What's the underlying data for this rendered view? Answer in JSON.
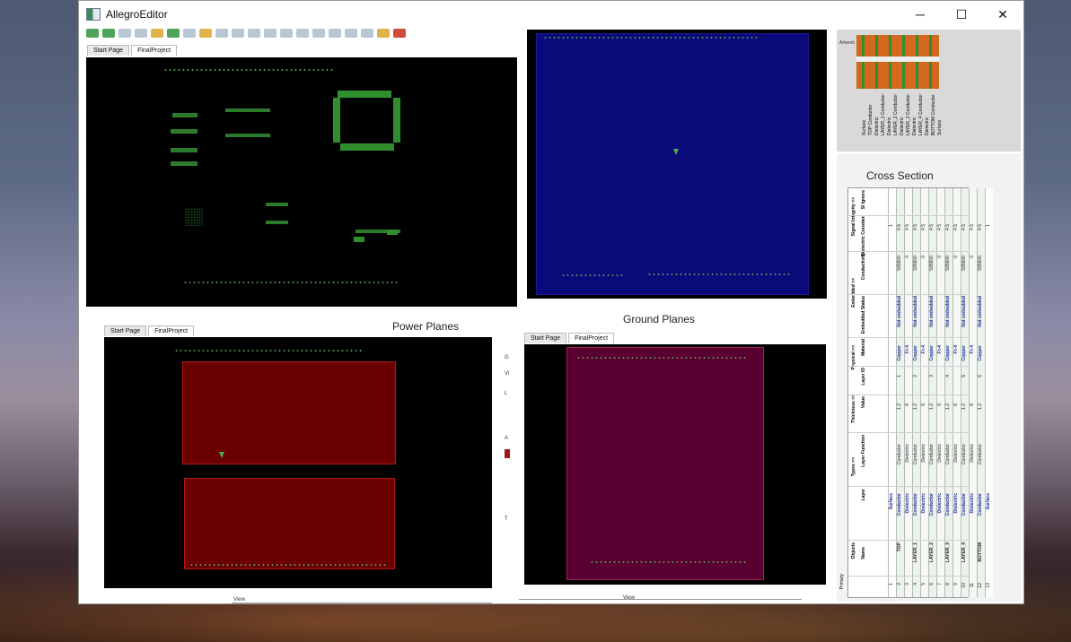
{
  "app": {
    "title": "AllegroEditor"
  },
  "window_controls": {
    "minimize": "─",
    "maximize": "☐",
    "close": "✕"
  },
  "tabs": {
    "start_page": "Start Page",
    "final_project": "FinalProject"
  },
  "captions": {
    "power_planes": "Power Planes",
    "ground_planes": "Ground Planes",
    "cross_section": "Cross Section"
  },
  "cross_section_table": {
    "group_headers": [
      "Objects",
      "Types >>",
      "Thickness >>",
      "Physical >>",
      "Embedded >>",
      "Signal Integrity >>"
    ],
    "column_headers": [
      "Name",
      "Layer",
      "Layer Function",
      "Value",
      "Layer ID",
      "Material",
      "Embedded Status",
      "Conductivity",
      "Dielectric Constant",
      "SI Ignore"
    ],
    "unit_headers": [
      "mil",
      "mho/cm"
    ],
    "side_label": "Primary",
    "rows": [
      {
        "num": "1",
        "name": "",
        "layer": "Surface",
        "function": "",
        "thickness": "",
        "id": "",
        "material": "",
        "embedded": "",
        "cond": "",
        "dk": "1"
      },
      {
        "num": "2",
        "name": "TOP",
        "layer": "Conductor",
        "function": "Conductor",
        "thickness": "1.2",
        "id": "1",
        "material": "Copper",
        "embedded": "Not embedded",
        "cond": "595900",
        "dk": "4.5"
      },
      {
        "num": "3",
        "name": "",
        "layer": "Dielectric",
        "function": "Dielectric",
        "thickness": "8",
        "id": "",
        "material": "Fr-4",
        "embedded": "",
        "cond": "0",
        "dk": "4.5"
      },
      {
        "num": "4",
        "name": "LAYER_1",
        "layer": "Conductor",
        "function": "Conductor",
        "thickness": "1.2",
        "id": "2",
        "material": "Copper",
        "embedded": "Not embedded",
        "cond": "595900",
        "dk": "4.5"
      },
      {
        "num": "5",
        "name": "",
        "layer": "Dielectric",
        "function": "Dielectric",
        "thickness": "8",
        "id": "",
        "material": "Fr-4",
        "embedded": "",
        "cond": "0",
        "dk": "4.5"
      },
      {
        "num": "6",
        "name": "LAYER_2",
        "layer": "Conductor",
        "function": "Conductor",
        "thickness": "1.2",
        "id": "3",
        "material": "Copper",
        "embedded": "Not embedded",
        "cond": "595900",
        "dk": "4.5"
      },
      {
        "num": "7",
        "name": "",
        "layer": "Dielectric",
        "function": "Dielectric",
        "thickness": "8",
        "id": "",
        "material": "Fr-4",
        "embedded": "",
        "cond": "0",
        "dk": "4.5"
      },
      {
        "num": "8",
        "name": "LAYER_3",
        "layer": "Conductor",
        "function": "Conductor",
        "thickness": "1.2",
        "id": "4",
        "material": "Copper",
        "embedded": "Not embedded",
        "cond": "595900",
        "dk": "4.5"
      },
      {
        "num": "9",
        "name": "",
        "layer": "Dielectric",
        "function": "Dielectric",
        "thickness": "8",
        "id": "",
        "material": "Fr-4",
        "embedded": "",
        "cond": "0",
        "dk": "4.5"
      },
      {
        "num": "10",
        "name": "LAYER_4",
        "layer": "Conductor",
        "function": "Conductor",
        "thickness": "1.2",
        "id": "5",
        "material": "Copper",
        "embedded": "Not embedded",
        "cond": "595900",
        "dk": "4.5"
      },
      {
        "num": "11",
        "name": "",
        "layer": "Dielectric",
        "function": "Dielectric",
        "thickness": "8",
        "id": "",
        "material": "Fr-4",
        "embedded": "",
        "cond": "0",
        "dk": "4.5"
      },
      {
        "num": "12",
        "name": "BOTTOM",
        "layer": "Conductor",
        "function": "Conductor",
        "thickness": "1.2",
        "id": "6",
        "material": "Copper",
        "embedded": "Not embedded",
        "cond": "595900",
        "dk": "4.5"
      },
      {
        "num": "13",
        "name": "",
        "layer": "Surface",
        "function": "",
        "thickness": "",
        "id": "",
        "material": "",
        "embedded": "",
        "cond": "",
        "dk": "1"
      }
    ]
  },
  "stackup_thumbnail": {
    "header": "Artwork",
    "layers": [
      "Surface",
      "TOP Conductor",
      "Dielectric",
      "LAYER_1 Conductor",
      "Dielectric",
      "LAYER_2 Conductor",
      "Dielectric",
      "LAYER_3 Conductor",
      "Dielectric",
      "LAYER_4 Conductor",
      "Dielectric",
      "BOTTOM Conductor",
      "Surface"
    ]
  },
  "bottom_bars": {
    "view_label": "View"
  },
  "side_strip": {
    "labels": [
      "G",
      "Vi",
      "L",
      "A",
      "T"
    ]
  },
  "colors": {
    "pcb_black": "#000000",
    "top_layer_blue": "#0a0a7a",
    "power_plane_red": "#6b0000",
    "ground_plane_purple": "#5a0030",
    "trace_green": "#2f8f2f",
    "stackup_orange": "#d2691e"
  }
}
